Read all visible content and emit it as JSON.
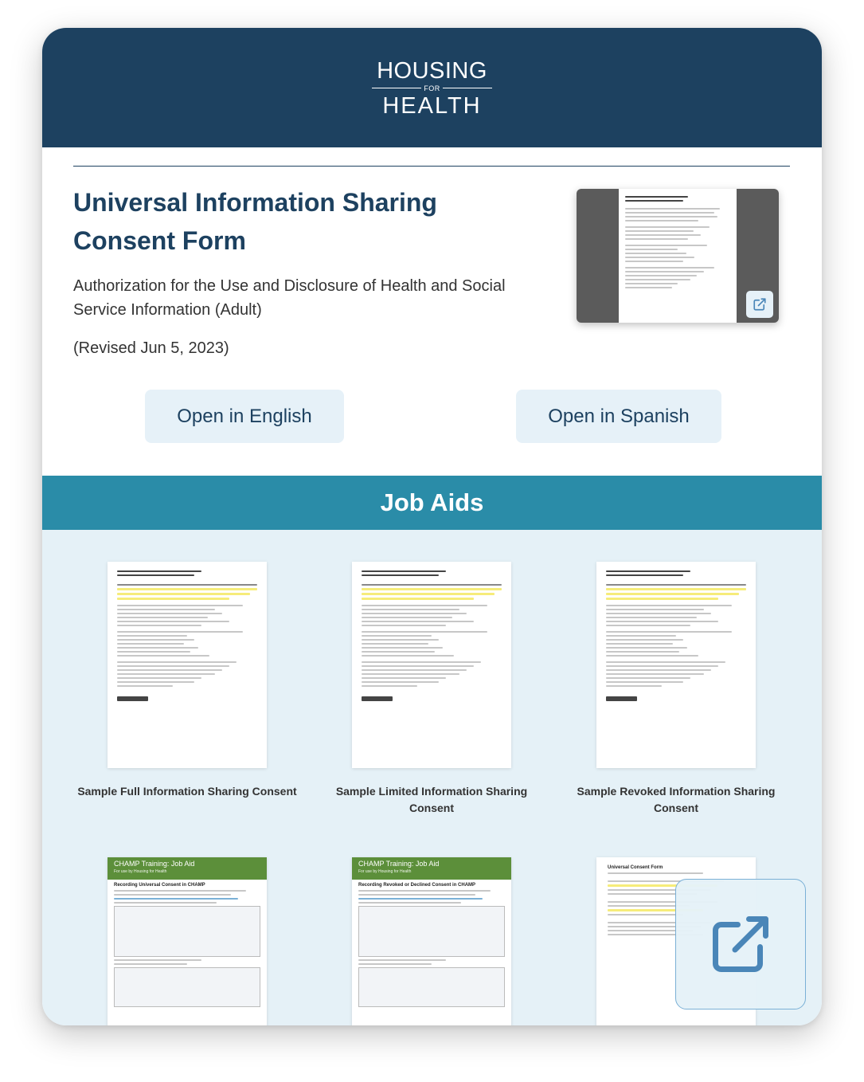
{
  "logo": {
    "top": "HOUSING",
    "middle": "FOR",
    "bottom": "HEALTH"
  },
  "form": {
    "title": "Universal Information Sharing Consent Form",
    "subtitle": "Authorization for the Use and Disclosure of Health and Social Service Information (Adult)",
    "revised": "(Revised Jun 5, 2023)",
    "open_english": "Open in English",
    "open_spanish": "Open in Spanish"
  },
  "job_aids": {
    "heading": "Job Aids",
    "items": [
      {
        "label": "Sample Full Information Sharing Consent"
      },
      {
        "label": "Sample Limited Information Sharing Consent"
      },
      {
        "label": "Sample Revoked Information Sharing Consent"
      }
    ],
    "training": [
      {
        "header": "CHAMP Training: Job Aid",
        "title": "Recording Universal Consent in CHAMP"
      },
      {
        "header": "CHAMP Training: Job Aid",
        "title": "Recording Revoked or Declined Consent in CHAMP"
      },
      {
        "header": "",
        "title": "Universal Consent Form"
      }
    ]
  },
  "colors": {
    "brand": "#1d4160",
    "band": "#2a8ca8",
    "button_bg": "#e6f1f8",
    "aids_bg": "#e5f1f7"
  },
  "icons": {
    "open": "external-link-icon"
  }
}
